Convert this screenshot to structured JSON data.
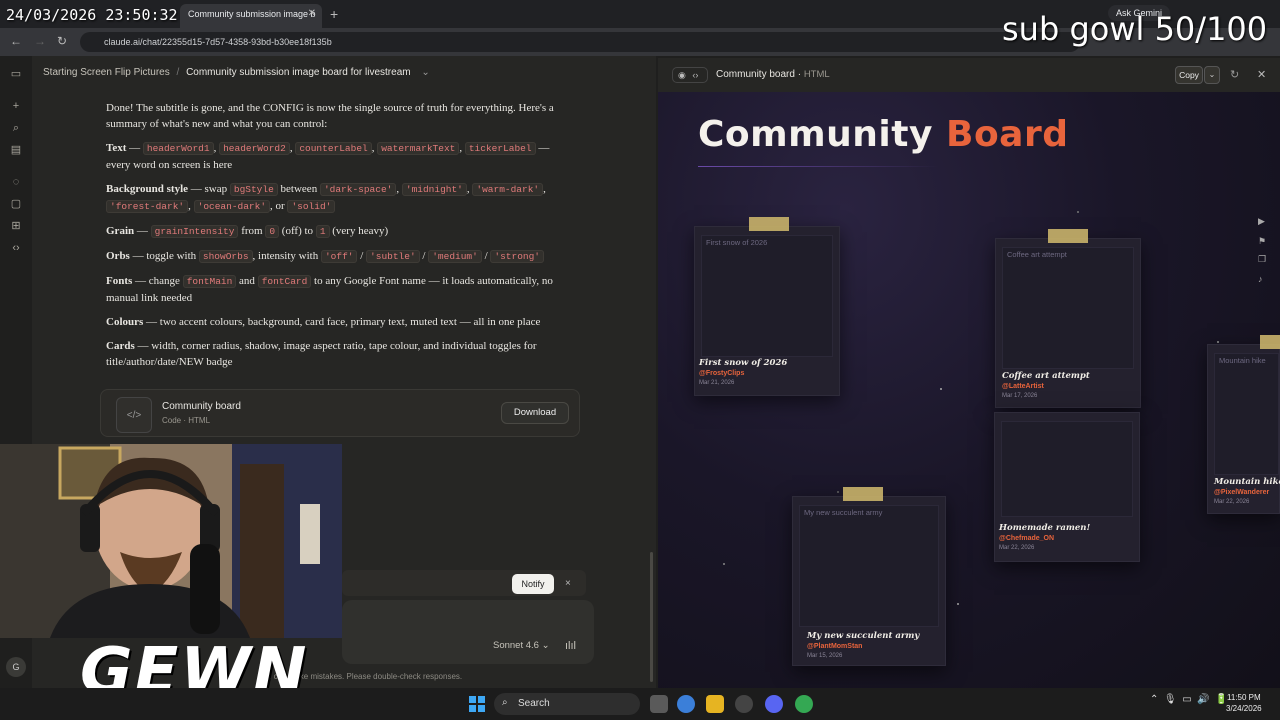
{
  "overlay": {
    "clock": "24/03/2026 23:50:32",
    "sub_goal": "sub gowl 50/100",
    "logo": "GEWN"
  },
  "browser": {
    "tab_title": "Community submission image b",
    "url": "claude.ai/chat/22355d15-7d57-4358-93bd-b30ee18f135b",
    "ask_gemini": "Ask Gemini"
  },
  "breadcrumb": {
    "project": "Starting Screen Flip Pictures",
    "separator": "/",
    "chat": "Community submission image board for livestream",
    "chevron": "⌄"
  },
  "chat": {
    "intro": "Done! The subtitle is gone, and the CONFIG is now the single source of truth for everything. Here's a summary of what's new and what you can control:",
    "text": {
      "label": "Text",
      "dash": " — ",
      "codes": [
        "headerWord1",
        "headerWord2",
        "counterLabel",
        "watermarkText",
        "tickerLabel"
      ],
      "rest": " — every word on screen is here"
    },
    "bg": {
      "label": "Background style",
      "mid": " — swap ",
      "code1": "bgStyle",
      "mid2": " between ",
      "codes": [
        "'dark-space'",
        "'midnight'",
        "'warm-dark'",
        "'forest-dark'",
        "'ocean-dark'"
      ],
      "or": ", or ",
      "last": "'solid'"
    },
    "grain": {
      "label": "Grain",
      "mid": " — ",
      "code1": "grainIntensity",
      "from": " from ",
      "code2": "0",
      "off": " (off) to ",
      "code3": "1",
      "heavy": " (very heavy)"
    },
    "orbs": {
      "label": "Orbs",
      "mid": " — toggle with ",
      "code1": "showOrbs",
      "mid2": ", intensity with ",
      "codes": [
        "'off'",
        "'subtle'",
        "'medium'",
        "'strong'"
      ]
    },
    "fonts": {
      "label": "Fonts",
      "mid": " — change ",
      "code1": "fontMain",
      "and": " and ",
      "code2": "fontCard",
      "rest": " to any Google Font name — it loads automatically, no manual link needed"
    },
    "colours": {
      "label": "Colours",
      "rest": " — two accent colours, background, card face, primary text, muted text — all in one place"
    },
    "cards": {
      "label": "Cards",
      "rest": " — width, corner radius, shadow, image aspect ratio, tape colour, and individual toggles for title/author/date/NEW badge"
    }
  },
  "artifact_card": {
    "title": "Community board",
    "subtitle": "Code · HTML",
    "download": "Download",
    "icon": "</>"
  },
  "notify": {
    "label": "Notify",
    "close": "×"
  },
  "composer": {
    "model": "Sonnet 4.6",
    "model_chevron": "⌄",
    "disclaimer": "and can make mistakes. Please double-check responses.",
    "avatar": "G"
  },
  "panel": {
    "title": "Community board",
    "type": "HTML",
    "copy": "Copy"
  },
  "board": {
    "word1": "Community",
    "word2": "Board",
    "cards": [
      {
        "alt": "First snow of 2026",
        "title": "First snow of 2026",
        "author": "@FrostyClips",
        "date": "Mar 21, 2026"
      },
      {
        "alt": "Coffee art attempt",
        "title": "Coffee art attempt",
        "author": "@LatteArtist",
        "date": "Mar 17, 2026"
      },
      {
        "alt": "Mountain hike",
        "title": "Mountain hike d",
        "author": "@PixelWanderer",
        "date": "Mar 22, 2026"
      },
      {
        "alt": "",
        "title": "Homemade ramen!",
        "author": "@Chefmade_ON",
        "date": "Mar 22, 2026"
      },
      {
        "alt": "My new succulent army",
        "title": "My new succulent army",
        "author": "@PlantMomStan",
        "date": "Mar 15, 2026"
      }
    ],
    "colors": {
      "accent": "#e8643c",
      "tape": "#c9b26a",
      "bg": "#1a1628"
    }
  },
  "taskbar": {
    "search": "Search",
    "time": "11:50 PM",
    "date": "3/24/2026"
  }
}
